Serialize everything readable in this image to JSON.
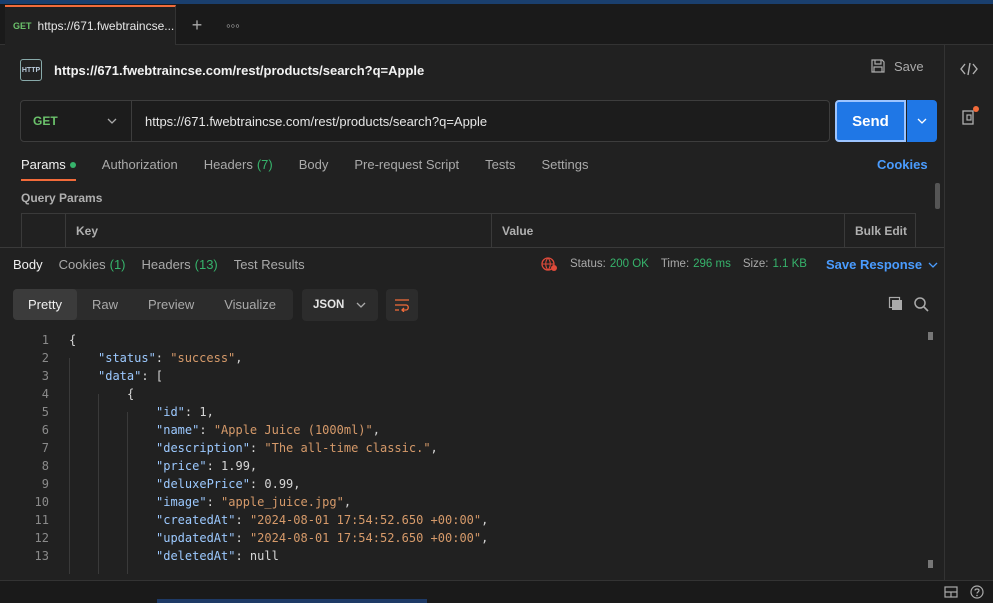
{
  "tab": {
    "method": "GET",
    "title": "https://671.fwebtraincse..."
  },
  "request": {
    "title": "https://671.fwebtraincse.com/rest/products/search?q=Apple",
    "save_label": "Save",
    "method": "GET",
    "url": "https://671.fwebtraincse.com/rest/products/search?q=Apple",
    "send_label": "Send"
  },
  "req_tabs": {
    "params": "Params",
    "authorization": "Authorization",
    "headers": "Headers",
    "headers_count": "(7)",
    "body": "Body",
    "prerequest": "Pre-request Script",
    "tests": "Tests",
    "settings": "Settings",
    "cookies": "Cookies"
  },
  "query_params": {
    "title": "Query Params",
    "col_key": "Key",
    "col_value": "Value",
    "bulk_edit": "Bulk Edit"
  },
  "response": {
    "tabs": {
      "body": "Body",
      "cookies": "Cookies",
      "cookies_count": "(1)",
      "headers": "Headers",
      "headers_count": "(13)",
      "tests": "Test Results"
    },
    "status_label": "Status:",
    "status_value": "200 OK",
    "time_label": "Time:",
    "time_value": "296 ms",
    "size_label": "Size:",
    "size_value": "1.1 KB",
    "save_response": "Save Response",
    "views": {
      "pretty": "Pretty",
      "raw": "Raw",
      "preview": "Preview",
      "visualize": "Visualize"
    },
    "format": "JSON"
  },
  "code_lines": [
    {
      "n": "1",
      "tokens": [
        {
          "t": "p",
          "v": "{"
        }
      ]
    },
    {
      "n": "2",
      "tokens": [
        {
          "t": "k",
          "v": "\"status\""
        },
        {
          "t": "p",
          "v": ": "
        },
        {
          "t": "s",
          "v": "\"success\""
        },
        {
          "t": "p",
          "v": ","
        }
      ]
    },
    {
      "n": "3",
      "tokens": [
        {
          "t": "k",
          "v": "\"data\""
        },
        {
          "t": "p",
          "v": ": ["
        }
      ]
    },
    {
      "n": "4",
      "tokens": [
        {
          "t": "p",
          "v": "{"
        }
      ]
    },
    {
      "n": "5",
      "tokens": [
        {
          "t": "k",
          "v": "\"id\""
        },
        {
          "t": "p",
          "v": ": 1,"
        }
      ]
    },
    {
      "n": "6",
      "tokens": [
        {
          "t": "k",
          "v": "\"name\""
        },
        {
          "t": "p",
          "v": ": "
        },
        {
          "t": "s",
          "v": "\"Apple Juice (1000ml)\""
        },
        {
          "t": "p",
          "v": ","
        }
      ]
    },
    {
      "n": "7",
      "tokens": [
        {
          "t": "k",
          "v": "\"description\""
        },
        {
          "t": "p",
          "v": ": "
        },
        {
          "t": "s",
          "v": "\"The all-time classic.\""
        },
        {
          "t": "p",
          "v": ","
        }
      ]
    },
    {
      "n": "8",
      "tokens": [
        {
          "t": "k",
          "v": "\"price\""
        },
        {
          "t": "p",
          "v": ": 1.99,"
        }
      ]
    },
    {
      "n": "9",
      "tokens": [
        {
          "t": "k",
          "v": "\"deluxePrice\""
        },
        {
          "t": "p",
          "v": ": 0.99,"
        }
      ]
    },
    {
      "n": "10",
      "tokens": [
        {
          "t": "k",
          "v": "\"image\""
        },
        {
          "t": "p",
          "v": ": "
        },
        {
          "t": "s",
          "v": "\"apple_juice.jpg\""
        },
        {
          "t": "p",
          "v": ","
        }
      ]
    },
    {
      "n": "11",
      "tokens": [
        {
          "t": "k",
          "v": "\"createdAt\""
        },
        {
          "t": "p",
          "v": ": "
        },
        {
          "t": "s",
          "v": "\"2024-08-01 17:54:52.650 +00:00\""
        },
        {
          "t": "p",
          "v": ","
        }
      ]
    },
    {
      "n": "12",
      "tokens": [
        {
          "t": "k",
          "v": "\"updatedAt\""
        },
        {
          "t": "p",
          "v": ": "
        },
        {
          "t": "s",
          "v": "\"2024-08-01 17:54:52.650 +00:00\""
        },
        {
          "t": "p",
          "v": ","
        }
      ]
    },
    {
      "n": "13",
      "tokens": [
        {
          "t": "k",
          "v": "\"deletedAt\""
        },
        {
          "t": "p",
          "v": ": null"
        }
      ]
    }
  ]
}
